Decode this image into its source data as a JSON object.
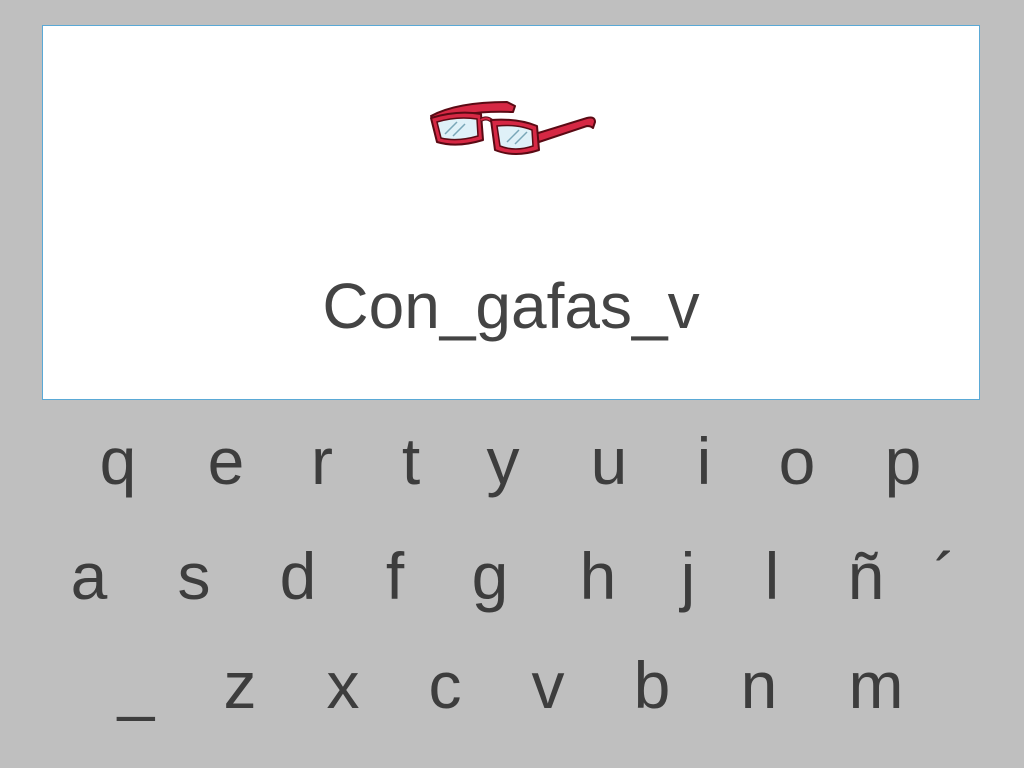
{
  "prompt": {
    "image": "glasses-icon",
    "phrase": "Con_gafas_v"
  },
  "keyboard": {
    "row1": [
      "q",
      "e",
      "r",
      "t",
      "y",
      "u",
      "i",
      "o",
      "p"
    ],
    "row2": [
      "a",
      "s",
      "d",
      "f",
      "g",
      "h",
      "j",
      "l",
      "ñ",
      "´"
    ],
    "row3": [
      "_",
      "z",
      "x",
      "c",
      "v",
      "b",
      "n",
      "m"
    ]
  },
  "colors": {
    "background": "#bfbfbf",
    "panel": "#ffffff",
    "panel_border": "#5aa9d6",
    "text": "#444444",
    "glasses_frame": "#d62844"
  }
}
